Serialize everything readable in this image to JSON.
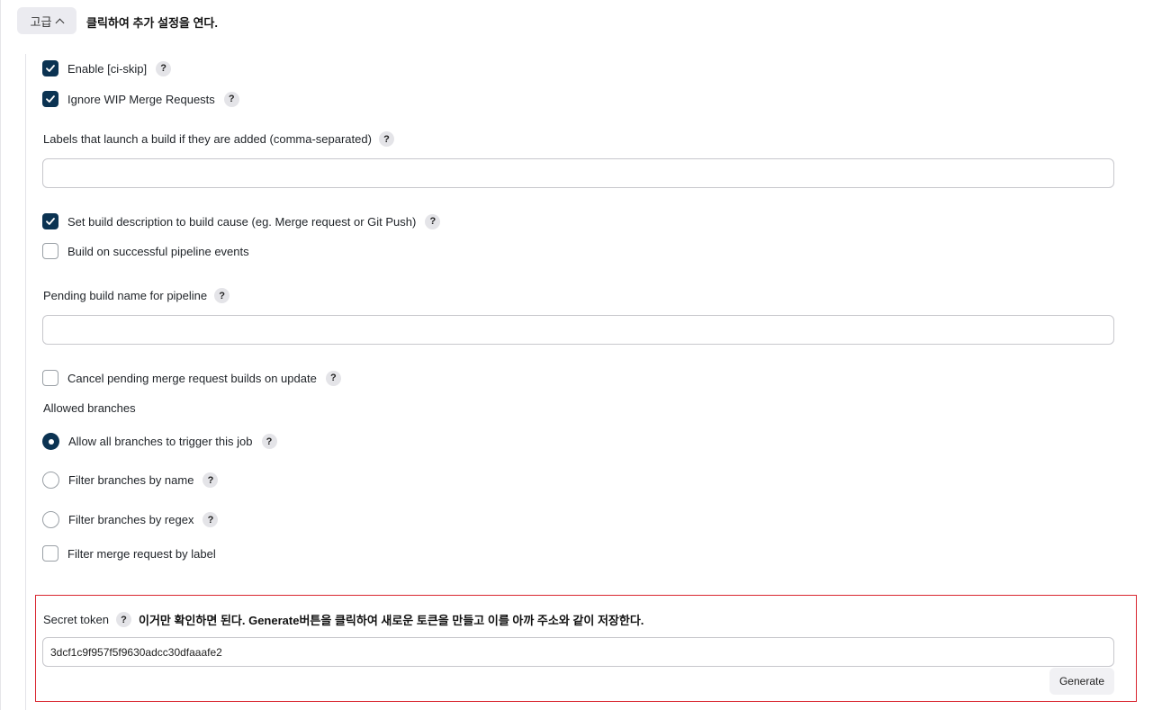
{
  "advanced": {
    "label": "고급",
    "annotation": "클릭하여 추가 설정을 연다."
  },
  "options": {
    "ci_skip": {
      "label": "Enable [ci-skip]",
      "checked": true
    },
    "ignore_wip": {
      "label": "Ignore WIP Merge Requests",
      "checked": true
    },
    "labels_launch": {
      "label": "Labels that launch a build if they are added (comma-separated)",
      "value": ""
    },
    "set_build_desc": {
      "label": "Set build description to build cause (eg. Merge request or Git Push)",
      "checked": true
    },
    "build_on_pipeline": {
      "label": "Build on successful pipeline events",
      "checked": false
    },
    "pending_build_name": {
      "label": "Pending build name for pipeline",
      "value": ""
    },
    "cancel_pending": {
      "label": "Cancel pending merge request builds on update",
      "checked": false
    }
  },
  "allowed_branches": {
    "heading": "Allowed branches",
    "all": {
      "label": "Allow all branches to trigger this job",
      "selected": true
    },
    "by_name": {
      "label": "Filter branches by name",
      "selected": false
    },
    "by_regex": {
      "label": "Filter branches by regex",
      "selected": false
    },
    "by_label": {
      "label": "Filter merge request by label",
      "checked": false
    }
  },
  "secret": {
    "label": "Secret token",
    "annotation": "이거만 확인하면 된다. Generate버튼을 클릭하여 새로운 토큰을 만들고 이를 아까 주소와 같이 저장한다.",
    "value": "3dcf1c9f957f5f9630adcc30dfaaafe2",
    "generate_label": "Generate"
  },
  "help_glyph": "?",
  "colors": {
    "checked": "#0b3352",
    "highlight_border": "#d9252f"
  }
}
